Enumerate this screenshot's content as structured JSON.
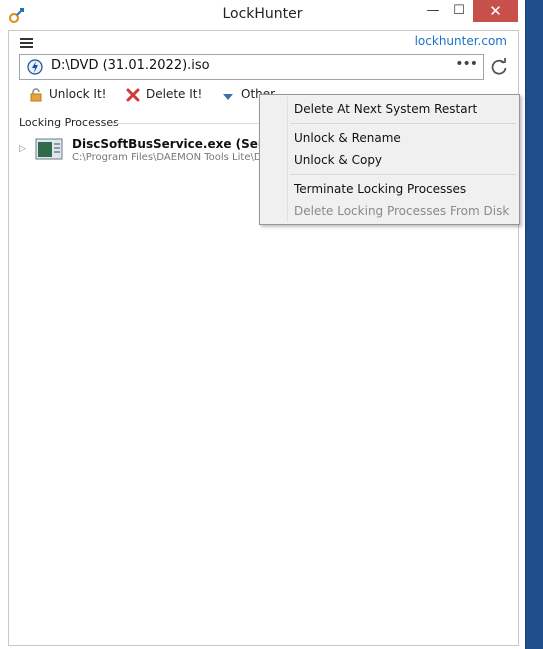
{
  "window": {
    "title": "LockHunter",
    "minimize": "—",
    "maximize": "☐",
    "close": "✕"
  },
  "header": {
    "site_link": "lockhunter.com"
  },
  "path": {
    "value": "D:\\DVD (31.01.2022).iso",
    "browse": "•••"
  },
  "toolbar": {
    "unlock": "Unlock It!",
    "delete": "Delete It!",
    "other": "Other"
  },
  "locking": {
    "header": "Locking Processes",
    "processes": [
      {
        "name": "DiscSoftBusService.exe (Service:",
        "path": "C:\\Program Files\\DAEMON Tools Lite\\Dis"
      }
    ]
  },
  "context_menu": {
    "items": [
      {
        "label": "Delete At Next System Restart",
        "enabled": true
      },
      {
        "label": "Unlock & Rename",
        "enabled": true
      },
      {
        "label": "Unlock & Copy",
        "enabled": true
      },
      {
        "label": "Terminate Locking Processes",
        "enabled": true
      },
      {
        "label": "Delete Locking Processes From Disk",
        "enabled": false
      }
    ]
  },
  "colors": {
    "accent_link": "#1a73c8",
    "close_button": "#c7504b",
    "desktop": "#1f4e8c"
  },
  "icons": [
    "app-lock-icon",
    "hamburger-menu-icon",
    "browse-dots-icon",
    "refresh-icon",
    "unlock-icon",
    "delete-x-icon",
    "dropdown-arrow-icon",
    "process-icon",
    "expander-arrow-icon"
  ]
}
